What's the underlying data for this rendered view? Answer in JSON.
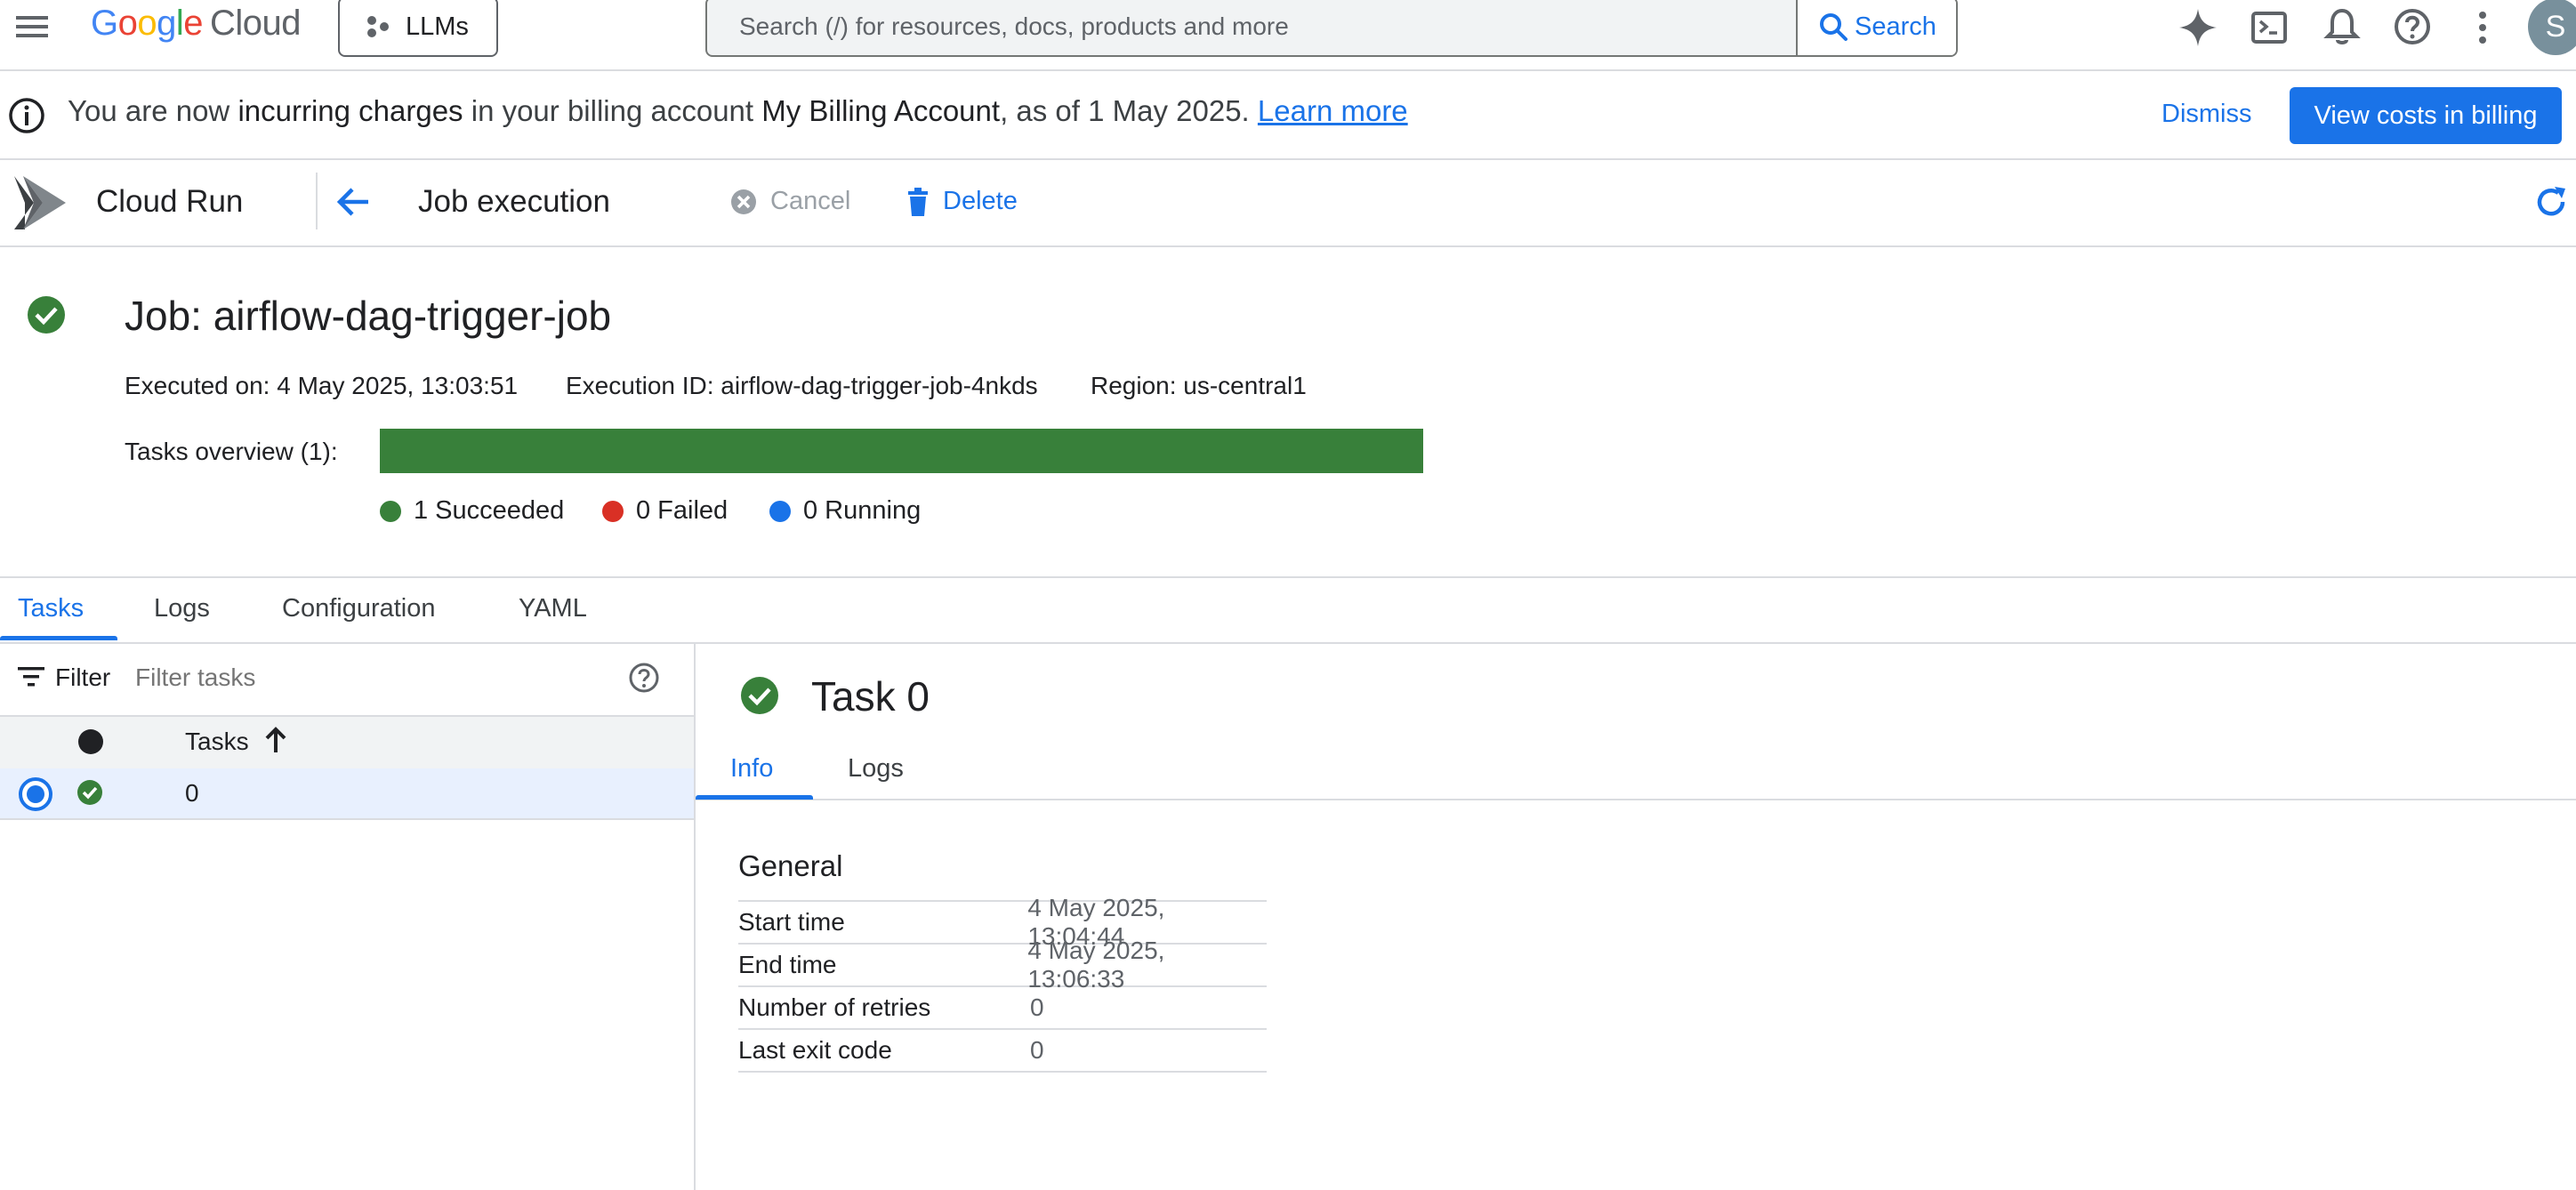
{
  "topbar": {
    "logo_google": "Google",
    "logo_cloud": "Cloud",
    "project": "LLMs",
    "search_placeholder": "Search (/) for resources, docs, products and more",
    "search_button": "Search",
    "avatar_initial": "S"
  },
  "banner": {
    "text_1": "You are now ",
    "text_bold_1": "incurring charges",
    "text_2": " in your billing account ",
    "text_bold_2": "My Billing Account",
    "text_3": ", as of 1 May 2025. ",
    "link": "Learn more",
    "dismiss": "Dismiss",
    "view_costs": "View costs in billing"
  },
  "toolbar": {
    "product": "Cloud Run",
    "page": "Job execution",
    "cancel": "Cancel",
    "delete": "Delete"
  },
  "job": {
    "title": "Job: airflow-dag-trigger-job",
    "executed_on": "Executed on: 4 May 2025, 13:03:51",
    "execution_id": "Execution ID: airflow-dag-trigger-job-4nkds",
    "region": "Region: us-central1",
    "tasks_overview": "Tasks overview (1):",
    "succeeded": "1 Succeeded",
    "failed": "0 Failed",
    "running": "0 Running",
    "succeeded_fraction": 1.0
  },
  "tabs": [
    "Tasks",
    "Logs",
    "Configuration",
    "YAML"
  ],
  "task_list": {
    "filter_label": "Filter",
    "filter_placeholder": "Filter tasks",
    "column_tasks": "Tasks",
    "rows": [
      {
        "index": "0",
        "status": "succeeded"
      }
    ]
  },
  "task_detail": {
    "title": "Task 0",
    "subtabs": [
      "Info",
      "Logs"
    ],
    "section": "General",
    "fields": [
      {
        "key": "Start time",
        "value": "4 May 2025, 13:04:44"
      },
      {
        "key": "End time",
        "value": "4 May 2025, 13:06:33"
      },
      {
        "key": "Number of retries",
        "value": "0"
      },
      {
        "key": "Last exit code",
        "value": "0"
      }
    ]
  },
  "colors": {
    "accent": "#1a73e8",
    "success": "#38803a",
    "failed": "#d93025",
    "running": "#1a73e8"
  }
}
